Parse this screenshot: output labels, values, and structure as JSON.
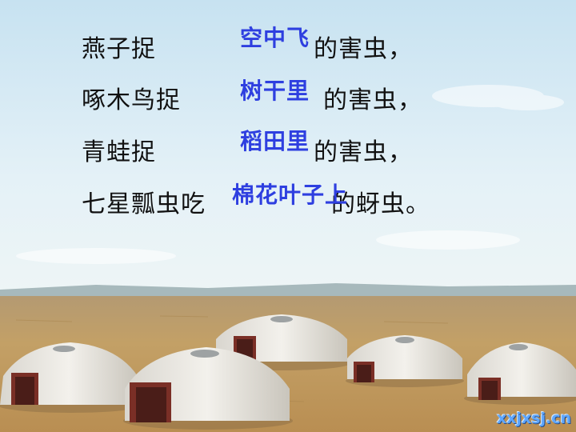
{
  "sentences": [
    {
      "prefix": "燕子捉",
      "answer": "空中飞",
      "suffix": "的害虫，"
    },
    {
      "prefix": "啄木鸟捉",
      "answer": "树干里",
      "suffix": "的害虫，"
    },
    {
      "prefix": "青蛙捉",
      "answer": "稻田里",
      "suffix": "的害虫，"
    },
    {
      "prefix": "七星瓢虫吃",
      "answer": "棉花叶子上",
      "suffix": "的蚜虫。"
    }
  ],
  "watermark": "xxjxsj.cn",
  "colors": {
    "answer_text": "#2e3fe0",
    "sky_top": "#c9e3f2",
    "ground": "#c09a63"
  }
}
